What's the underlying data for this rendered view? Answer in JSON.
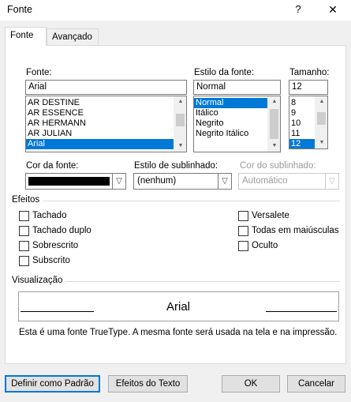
{
  "window": {
    "title": "Fonte",
    "help_label": "?",
    "close_label": "✕"
  },
  "tabs": [
    {
      "label": "Fonte",
      "active": true
    },
    {
      "label": "Avançado",
      "active": false
    }
  ],
  "font": {
    "label": "Fonte:",
    "value": "Arial",
    "items": [
      "AR DESTINE",
      "AR ESSENCE",
      "AR HERMANN",
      "AR JULIAN",
      "Arial"
    ],
    "selected": "Arial"
  },
  "style": {
    "label": "Estilo da fonte:",
    "value": "Normal",
    "items": [
      "Normal",
      "Itálico",
      "Negrito",
      "Negrito Itálico"
    ],
    "selected": "Normal"
  },
  "size": {
    "label": "Tamanho:",
    "value": "12",
    "items": [
      "8",
      "9",
      "10",
      "11",
      "12"
    ],
    "selected": "12"
  },
  "font_color": {
    "label": "Cor da fonte:",
    "color": "#000000"
  },
  "underline_style": {
    "label": "Estilo de sublinhado:",
    "value": "(nenhum)"
  },
  "underline_color": {
    "label": "Cor do sublinhado:",
    "value": "Automático"
  },
  "effects": {
    "title": "Efeitos",
    "left": [
      "Tachado",
      "Tachado duplo",
      "Sobrescrito",
      "Subscrito"
    ],
    "right": [
      "Versalete",
      "Todas em maiúsculas",
      "Oculto"
    ]
  },
  "preview": {
    "title": "Visualização",
    "sample": "Arial",
    "note": "Esta é uma fonte TrueType. A mesma fonte será usada na tela e na impressão."
  },
  "buttons": {
    "set_default": "Definir como Padrão",
    "text_effects": "Efeitos do Texto",
    "ok": "OK",
    "cancel": "Cancelar"
  },
  "colors": {
    "selection": "#0078d7",
    "dialog_bg": "#f0f0f0"
  }
}
